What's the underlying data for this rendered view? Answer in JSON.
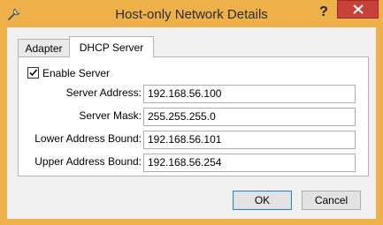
{
  "window": {
    "title": "Host-only Network Details",
    "help_glyph": "?",
    "icon": "wrench-icon"
  },
  "tabs": [
    {
      "label": "Adapter",
      "active": false
    },
    {
      "label": "DHCP Server",
      "active": true
    }
  ],
  "dhcp": {
    "enable_server": {
      "label": "Enable Server",
      "checked": true
    },
    "fields": [
      {
        "label": "Server Address:",
        "value": "192.168.56.100"
      },
      {
        "label": "Server Mask:",
        "value": "255.255.255.0"
      },
      {
        "label": "Lower Address Bound:",
        "value": "192.168.56.101"
      },
      {
        "label": "Upper Address Bound:",
        "value": "192.168.56.254"
      }
    ]
  },
  "buttons": {
    "ok": "OK",
    "cancel": "Cancel"
  },
  "colors": {
    "frame": "#eeb14a",
    "close": "#c7413a",
    "client": "#f0f0f0"
  }
}
